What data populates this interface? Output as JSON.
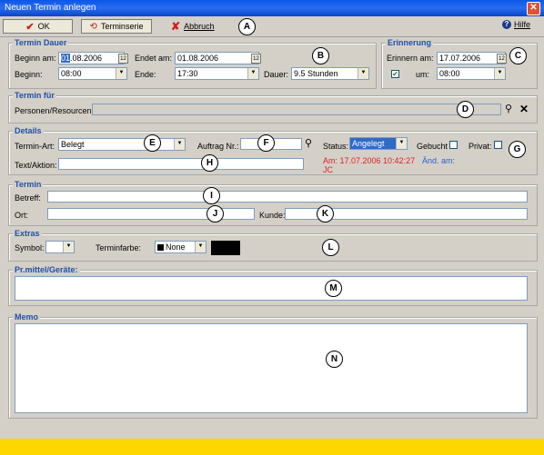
{
  "window": {
    "title": "Neuen Termin anlegen",
    "close": "✕"
  },
  "toolbar": {
    "ok": "OK",
    "series": "Terminserie",
    "cancel": "Abbruch",
    "help": "Hilfe"
  },
  "markers": {
    "a": "A",
    "b": "B",
    "c": "C",
    "d": "D",
    "e": "E",
    "f": "F",
    "g": "G",
    "h": "H",
    "i": "I",
    "j": "J",
    "k": "K",
    "l": "L",
    "m": "M",
    "n": "N"
  },
  "duration": {
    "legend": "Termin Dauer",
    "start_date_label": "Beginn am:",
    "start_date_day": "01",
    "start_date_rest": ".08.2006",
    "end_date_label": "Endet am:",
    "end_date": "01.08.2006",
    "start_time_label": "Beginn:",
    "start_time": "08:00",
    "end_time_label": "Ende:",
    "end_time": "17:30",
    "duration_label": "Dauer:",
    "duration": "9.5 Stunden"
  },
  "reminder": {
    "legend": "Erinnerung",
    "date_label": "Erinnern am:",
    "date": "17.07.2006",
    "time_label": "um:",
    "time": "08:00",
    "checked": true
  },
  "for": {
    "legend": "Termin für",
    "label": "Personen/Resourcen:",
    "value": ""
  },
  "details": {
    "legend": "Details",
    "type_label": "Termin-Art:",
    "type": "Belegt",
    "order_label": "Auftrag Nr.:",
    "order": "",
    "status_label": "Status:",
    "status": "Angelegt",
    "booked_label": "Gebucht",
    "private_label": "Privat:",
    "text_label": "Text/Aktion:",
    "text": "",
    "created_line1": "Am: 17.07.2006 10:42:27",
    "created_line2": "JC",
    "changed_label": "Änd. am:"
  },
  "appointment": {
    "legend": "Termin",
    "subject_label": "Betreff:",
    "place_label": "Ort:",
    "customer_label": "Kunde:"
  },
  "extras": {
    "legend": "Extras",
    "symbol_label": "Symbol:",
    "color_label": "Terminfarbe:",
    "color_value": "None",
    "swatch_color": "#000000"
  },
  "equipment": {
    "legend": "Pr.mittel/Geräte:"
  },
  "memo": {
    "legend": "Memo"
  },
  "colors": {
    "accent": "#2050a8",
    "status_bar": "#ffd700",
    "title_bar": "#0a58e6"
  }
}
